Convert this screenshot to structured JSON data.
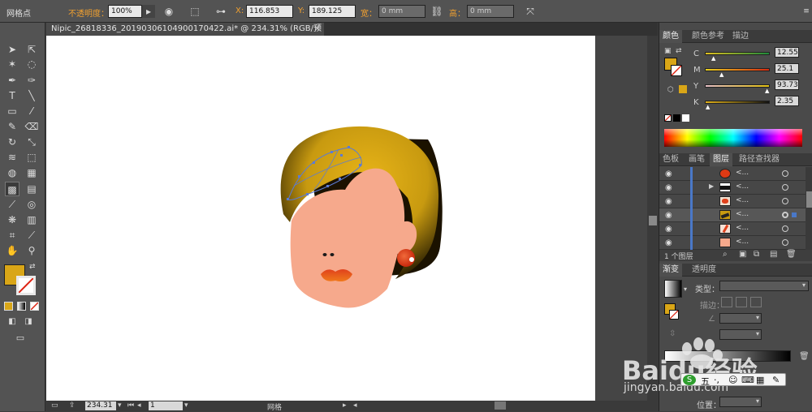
{
  "control_bar": {
    "mode_label": "网格点",
    "opacity_label": "不透明度：",
    "opacity_value": "100%",
    "x_label": "X:",
    "x_value": "116.853",
    "y_label": "Y:",
    "y_value": "189.125",
    "width_label": "宽：",
    "width_value": "0 mm",
    "height_label": "高：",
    "height_value": "0 mm"
  },
  "document_tab": {
    "title": "Nipic_26818336_20190306104900170422.ai* @ 234.31% (RGB/预览)",
    "close": "×"
  },
  "status_bar": {
    "zoom": "234.31",
    "page": "1",
    "tool_label": "网格"
  },
  "color_panel": {
    "tabs": [
      "颜色",
      "颜色参考",
      "描边"
    ],
    "fill_color": "#d9a617",
    "channels": [
      {
        "label": "C",
        "value": "12.55"
      },
      {
        "label": "M",
        "value": "25.1"
      },
      {
        "label": "Y",
        "value": "93.73"
      },
      {
        "label": "K",
        "value": "2.35"
      }
    ]
  },
  "layers_panel": {
    "tabs": [
      "色板",
      "画笔",
      "图层",
      "路径查找器"
    ],
    "layer_name": "<...",
    "footer": "1 个图层"
  },
  "gradient_panel": {
    "tabs": [
      "渐变",
      "透明度"
    ],
    "type_label": "类型：",
    "stroke_label": "描边：",
    "position_label": "位置："
  },
  "watermark": {
    "brand": "Baidu经验",
    "url": "jingyan.baidu.com",
    "ime": "五"
  },
  "colors": {
    "hair": "#c89a10",
    "skin": "#f6a98c",
    "lips": "#e0411c",
    "earring": "#d93a14",
    "accent_orange": "#f0a030"
  }
}
